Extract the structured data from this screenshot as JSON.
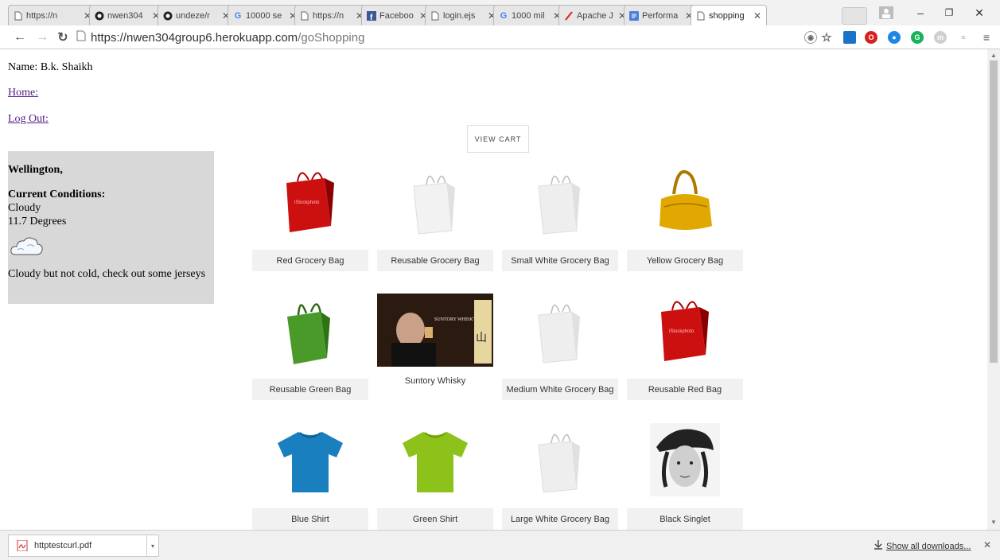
{
  "browser": {
    "tabs": [
      {
        "title": "https://n",
        "icon": "page-icon"
      },
      {
        "title": "nwen304",
        "icon": "github-icon"
      },
      {
        "title": "undeze/r",
        "icon": "github-icon"
      },
      {
        "title": "10000 se",
        "icon": "google-icon"
      },
      {
        "title": "https://n",
        "icon": "page-icon"
      },
      {
        "title": "Faceboo",
        "icon": "facebook-icon"
      },
      {
        "title": "login.ejs",
        "icon": "page-icon"
      },
      {
        "title": "1000 mil",
        "icon": "google-icon"
      },
      {
        "title": "Apache J",
        "icon": "apache-feather-icon"
      },
      {
        "title": "Performa",
        "icon": "docs-icon"
      },
      {
        "title": "shopping",
        "icon": "page-icon"
      }
    ],
    "url_host": "https://nwen304group6.herokuapp.com",
    "url_path": "/goShopping"
  },
  "page": {
    "user_name": "Name: B.k. Shaikh",
    "home_link": "Home:",
    "logout_link": "Log Out:",
    "view_cart": "VIEW CART",
    "weather": {
      "city": "Wellington,",
      "heading": "Current Conditions:",
      "condition": "Cloudy",
      "temperature": "11.7 Degrees",
      "icon": "cloud-icon",
      "message": "Cloudy but not cold, check out some jerseys"
    },
    "products": [
      {
        "name": "Red Grocery Bag",
        "image": "red-bag",
        "color": "#cc1010"
      },
      {
        "name": "Reusable Grocery Bag",
        "image": "white-bag",
        "color": "#f2f2f2"
      },
      {
        "name": "Small White Grocery Bag",
        "image": "white-bag",
        "color": "#eeeeee"
      },
      {
        "name": "Yellow Grocery Bag",
        "image": "yellow-handbag",
        "color": "#e0a800"
      },
      {
        "name": "Reusable Green Bag",
        "image": "green-bag",
        "color": "#4a9a2a"
      },
      {
        "name": "Suntory Whisky",
        "image": "whisky-photo",
        "color": "#2a1a10"
      },
      {
        "name": "Medium White Grocery Bag",
        "image": "white-bag",
        "color": "#eeeeee"
      },
      {
        "name": "Reusable Red Bag",
        "image": "red-bag",
        "color": "#cc1010"
      },
      {
        "name": "Blue Shirt",
        "image": "blue-shirt",
        "color": "#1a7fbf"
      },
      {
        "name": "Green Shirt",
        "image": "green-shirt",
        "color": "#8cc21a"
      },
      {
        "name": "Large White Grocery Bag",
        "image": "white-bag",
        "color": "#eeeeee"
      },
      {
        "name": "Black Singlet",
        "image": "bw-portrait",
        "color": "#222222"
      }
    ]
  },
  "downloads": {
    "file_name": "httptestcurl.pdf",
    "show_all": "Show all downloads..."
  }
}
